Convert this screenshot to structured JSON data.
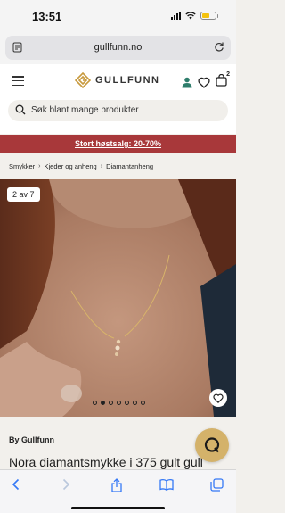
{
  "status_bar": {
    "time": "13:51"
  },
  "browser": {
    "url": "gullfunn.no"
  },
  "site": {
    "logo_text": "GULLFUNN",
    "cart_count": "2",
    "search_placeholder": "Søk blant mange produkter",
    "promo_text": "Stort høstsalg: 20-70%",
    "accent_color": "#a8383a",
    "gold_color": "#d4b26a",
    "teal_icon_color": "#2e7d6b"
  },
  "breadcrumb": [
    "Smykker",
    "Kjeder og anheng",
    "Diamantanheng"
  ],
  "product": {
    "image_counter": "2 av 7",
    "dot_count": 7,
    "active_dot": 1,
    "brand": "By Gullfunn",
    "title": "Nora diamantsmykke i 375 gult gull"
  },
  "icons": {
    "status": [
      "signal-icon",
      "wifi-icon",
      "battery-icon"
    ],
    "address": [
      "reader-mode-icon",
      "reload-icon"
    ],
    "header": [
      "menu-icon",
      "account-icon",
      "heart-icon",
      "cart-icon"
    ],
    "toolbar": [
      "back-icon",
      "forward-icon",
      "share-icon",
      "bookmarks-icon",
      "tabs-icon"
    ],
    "chat": "chat-icon"
  }
}
